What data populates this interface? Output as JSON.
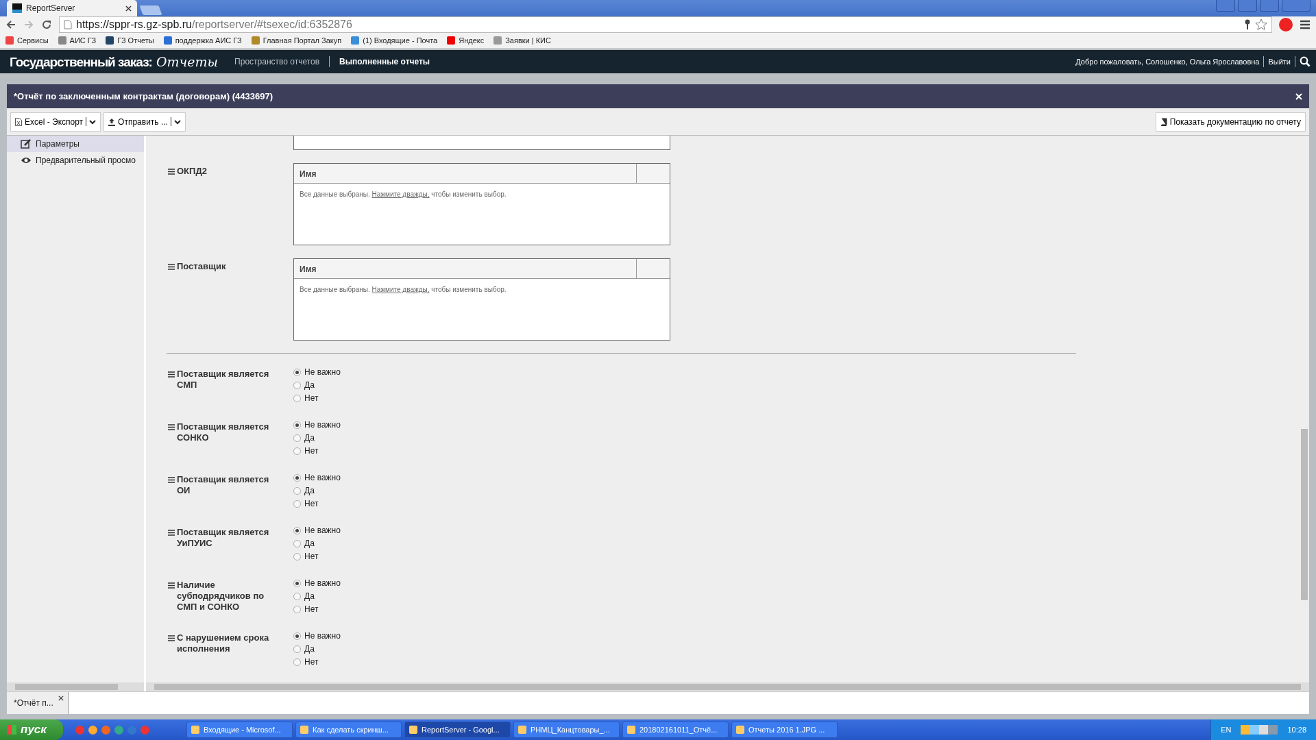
{
  "browser": {
    "tab_title": "ReportServer",
    "url_host": "https://sppr-rs.gz-spb.ru",
    "url_path": "/reportserver/#tsexec/id:6352876",
    "bookmarks": [
      {
        "label": "Сервисы",
        "kind": "apps"
      },
      {
        "label": "АИС ГЗ",
        "kind": "tool"
      },
      {
        "label": "ГЗ Отчеты",
        "kind": "rs"
      },
      {
        "label": "поддержка АИС ГЗ",
        "kind": "help"
      },
      {
        "label": "Главная Портал Закуп",
        "kind": "emblem"
      },
      {
        "label": "(1) Входящие - Почта",
        "kind": "mail"
      },
      {
        "label": "Яндекс",
        "kind": "yandex"
      },
      {
        "label": "Заявки | КИС",
        "kind": "page"
      }
    ]
  },
  "app": {
    "logo": "Государственный заказ:",
    "logo_script": "Отчеты",
    "nav": [
      {
        "label": "Пространство отчетов",
        "selected": false
      },
      {
        "label": "Выполненные отчеты",
        "selected": true
      }
    ],
    "welcome": "Добро пожаловать, Солошенко, Ольга Ярославовна",
    "logout": "Выйти"
  },
  "report": {
    "title": "*Отчёт по заключенным контрактам (договорам) (4433697)",
    "toolbar": [
      "Excel - Экспорт",
      "Отправить ..."
    ],
    "doc_button": "Показать документацию по отчету",
    "sidebar": [
      {
        "label": "Параметры",
        "selected": true,
        "kind": "edit"
      },
      {
        "label": "Предварительный просмо",
        "selected": false,
        "kind": "eye"
      }
    ],
    "list_params": [
      {
        "label": "ОКПД2",
        "column": "Имя",
        "note_before": "Все данные выбраны.",
        "note_link": "Нажмите дважды,",
        "note_after": "чтобы изменить выбор."
      },
      {
        "label": "Поставщик",
        "column": "Имя",
        "note_before": "Все данные выбраны.",
        "note_link": "Нажмите дважды,",
        "note_after": "чтобы изменить выбор."
      }
    ],
    "radio_params": [
      {
        "label": "Поставщик является СМП",
        "options": [
          {
            "label": "Не важно",
            "selected": true
          },
          {
            "label": "Да",
            "selected": false
          },
          {
            "label": "Нет",
            "selected": false
          }
        ]
      },
      {
        "label": "Поставщик является СОНКО",
        "options": [
          {
            "label": "Не важно",
            "selected": true
          },
          {
            "label": "Да",
            "selected": false
          },
          {
            "label": "Нет",
            "selected": false
          }
        ]
      },
      {
        "label": "Поставщик является ОИ",
        "options": [
          {
            "label": "Не важно",
            "selected": true
          },
          {
            "label": "Да",
            "selected": false
          },
          {
            "label": "Нет",
            "selected": false
          }
        ]
      },
      {
        "label": "Поставщик является УиПУИС",
        "options": [
          {
            "label": "Не важно",
            "selected": true
          },
          {
            "label": "Да",
            "selected": false
          },
          {
            "label": "Нет",
            "selected": false
          }
        ]
      },
      {
        "label": "Наличие субподрядчиков по СМП и СОНКО",
        "options": [
          {
            "label": "Не важно",
            "selected": true
          },
          {
            "label": "Да",
            "selected": false
          },
          {
            "label": "Нет",
            "selected": false
          }
        ]
      },
      {
        "label": "С нарушением срока исполнения",
        "options": [
          {
            "label": "Не важно",
            "selected": true
          },
          {
            "label": "Да",
            "selected": false
          },
          {
            "label": "Нет",
            "selected": false
          }
        ]
      }
    ]
  },
  "bottom_tabs": [
    {
      "label": "*Отчёт п..."
    }
  ],
  "taskbar": {
    "start": "пуск",
    "windows": [
      {
        "label": "Входящие - Microsof...",
        "selected": false
      },
      {
        "label": "Как сделать скринш...",
        "selected": false
      },
      {
        "label": "ReportServer - Googl...",
        "selected": true
      },
      {
        "label": "РНМЦ_Канцтовары_...",
        "selected": false
      },
      {
        "label": "201802161011_Отчё...",
        "selected": false
      },
      {
        "label": "Отчеты 2016 1.JPG ...",
        "selected": false
      }
    ],
    "lang": "EN",
    "clock": "10:28"
  }
}
